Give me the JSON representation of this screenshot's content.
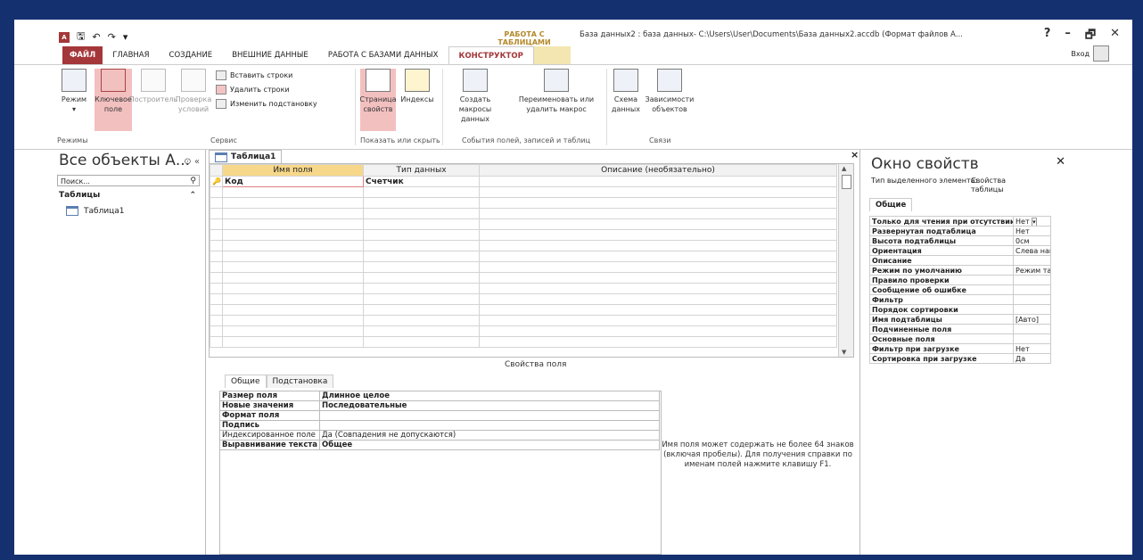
{
  "window": {
    "context_group": "РАБОТА С ТАБЛИЦАМИ",
    "doc_title": "База данных2 : база данных- C:\\Users\\User\\Documents\\База данных2.accdb (Формат файлов А...",
    "help": "?",
    "minimize": "–",
    "restore": "🗗",
    "close": "✕",
    "login": "Вход"
  },
  "tabs": [
    {
      "label": "ФАЙЛ"
    },
    {
      "label": "ГЛАВНАЯ"
    },
    {
      "label": "СОЗДАНИЕ"
    },
    {
      "label": "ВНЕШНИЕ ДАННЫЕ"
    },
    {
      "label": "РАБОТА С БАЗАМИ ДАННЫХ"
    },
    {
      "label": "КОНСТРУКТОР"
    }
  ],
  "ribbon": {
    "mode": "Режим",
    "key_field": "Ключевое поле",
    "builder": "Построитель",
    "check": "Проверка условий",
    "insert_rows": "Вставить строки",
    "delete_rows": "Удалить строки",
    "change_lookup": "Изменить подстановку",
    "property_sheet": "Страница свойств",
    "indexes": "Индексы",
    "create_macros": "Создать макросы данных",
    "rename_macro": "Переименовать или удалить макрос",
    "data_schema": "Схема данных",
    "dependencies": "Зависимости объектов",
    "groups": {
      "modes": "Режимы",
      "service": "Сервис",
      "show_hide": "Показать или скрыть",
      "events": "События полей, записей и таблиц",
      "relations": "Связи"
    }
  },
  "nav": {
    "title": "Все объекты А...",
    "search_placeholder": "Поиск...",
    "group": "Таблицы",
    "items": [
      {
        "label": "Таблица1"
      }
    ]
  },
  "doc_tab": "Таблица1",
  "grid": {
    "headers": [
      "Имя поля",
      "Тип данных",
      "Описание (необязательно)"
    ],
    "rows": [
      [
        "Код",
        "Счетчик",
        ""
      ]
    ]
  },
  "field_props": {
    "title": "Свойства поля",
    "tabs": [
      "Общие",
      "Подстановка"
    ],
    "rows": [
      {
        "k": "Размер поля",
        "v": "Длинное целое"
      },
      {
        "k": "Новые значения",
        "v": "Последовательные"
      },
      {
        "k": "Формат поля",
        "v": ""
      },
      {
        "k": "Подпись",
        "v": ""
      },
      {
        "k": "Индексированное поле",
        "v": "Да (Совпадения не допускаются)"
      },
      {
        "k": "Выравнивание текста",
        "v": "Общее"
      }
    ],
    "help": "Имя поля может содержать не более 64 знаков (включая пробелы). Для получения справки по именам полей нажмите клавишу F1."
  },
  "property_sheet": {
    "title": "Окно свойств",
    "selection_label": "Тип выделенного элемента:",
    "selection_value": "Свойства таблицы",
    "tab": "Общие",
    "rows": [
      {
        "k": "Только для чтения при отсутствии",
        "v": "Нет"
      },
      {
        "k": "Развернутая подтаблица",
        "v": "Нет"
      },
      {
        "k": "Высота подтаблицы",
        "v": "0см"
      },
      {
        "k": "Ориентация",
        "v": "Слева нап"
      },
      {
        "k": "Описание",
        "v": ""
      },
      {
        "k": "Режим по умолчанию",
        "v": "Режим та"
      },
      {
        "k": "Правило проверки",
        "v": ""
      },
      {
        "k": "Сообщение об ошибке",
        "v": ""
      },
      {
        "k": "Фильтр",
        "v": ""
      },
      {
        "k": "Порядок сортировки",
        "v": ""
      },
      {
        "k": "Имя подтаблицы",
        "v": "[Авто]"
      },
      {
        "k": "Подчиненные поля",
        "v": ""
      },
      {
        "k": "Основные поля",
        "v": ""
      },
      {
        "k": "Фильтр при загрузке",
        "v": "Нет"
      },
      {
        "k": "Сортировка при загрузке",
        "v": "Да"
      }
    ]
  }
}
